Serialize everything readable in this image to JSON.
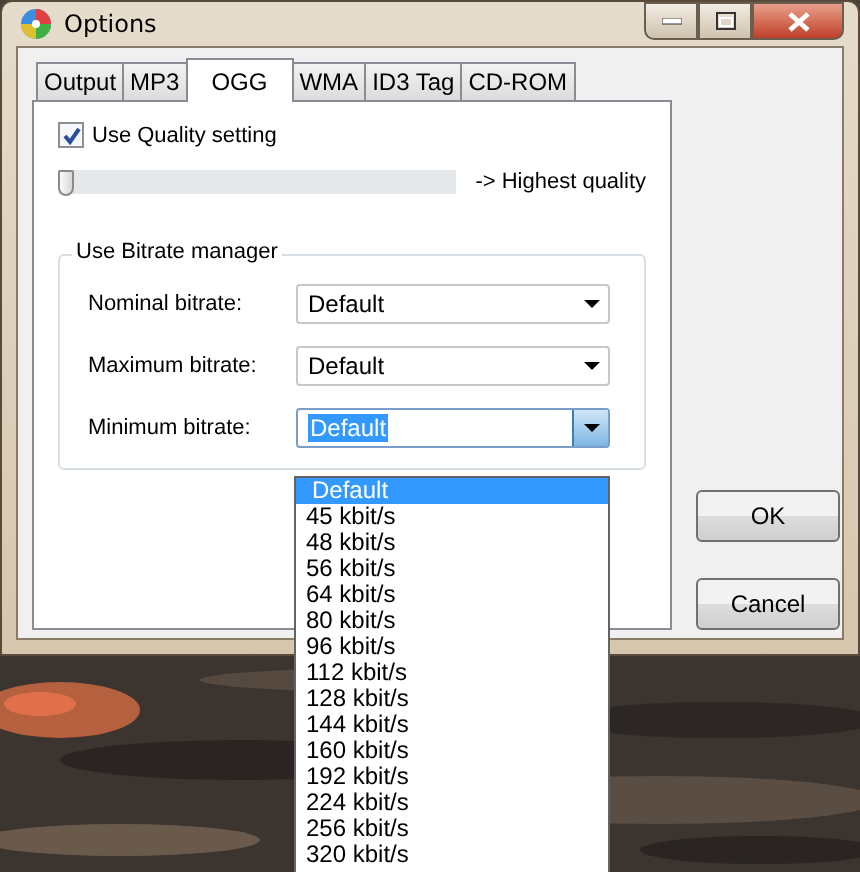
{
  "window": {
    "title": "Options"
  },
  "tabs": [
    {
      "label": "Output",
      "selected": false
    },
    {
      "label": "MP3",
      "selected": false
    },
    {
      "label": "OGG",
      "selected": true
    },
    {
      "label": "WMA",
      "selected": false
    },
    {
      "label": "ID3 Tag",
      "selected": false
    },
    {
      "label": "CD-ROM",
      "selected": false
    }
  ],
  "quality": {
    "label": "Use Quality setting",
    "checked": true
  },
  "slider": {
    "level": 0,
    "label": "-> Highest quality"
  },
  "bitrate_group": {
    "title": "Use Bitrate manager",
    "fields": [
      {
        "label": "Nominal bitrate:",
        "value": "Default",
        "focused": false
      },
      {
        "label": "Maximum bitrate:",
        "value": "Default",
        "focused": false
      },
      {
        "label": "Minimum bitrate:",
        "value": "Default",
        "focused": true
      }
    ]
  },
  "dropdown": {
    "options": [
      {
        "label": "Default",
        "selected": true
      },
      {
        "label": "45 kbit/s",
        "selected": false
      },
      {
        "label": "48 kbit/s",
        "selected": false
      },
      {
        "label": "56 kbit/s",
        "selected": false
      },
      {
        "label": "64 kbit/s",
        "selected": false
      },
      {
        "label": "80 kbit/s",
        "selected": false
      },
      {
        "label": "96 kbit/s",
        "selected": false
      },
      {
        "label": "112 kbit/s",
        "selected": false
      },
      {
        "label": "128 kbit/s",
        "selected": false
      },
      {
        "label": "144 kbit/s",
        "selected": false
      },
      {
        "label": "160 kbit/s",
        "selected": false
      },
      {
        "label": "192 kbit/s",
        "selected": false
      },
      {
        "label": "224 kbit/s",
        "selected": false
      },
      {
        "label": "256 kbit/s",
        "selected": false
      },
      {
        "label": "320 kbit/s",
        "selected": false
      }
    ]
  },
  "buttons": [
    "OK",
    "Cancel"
  ]
}
